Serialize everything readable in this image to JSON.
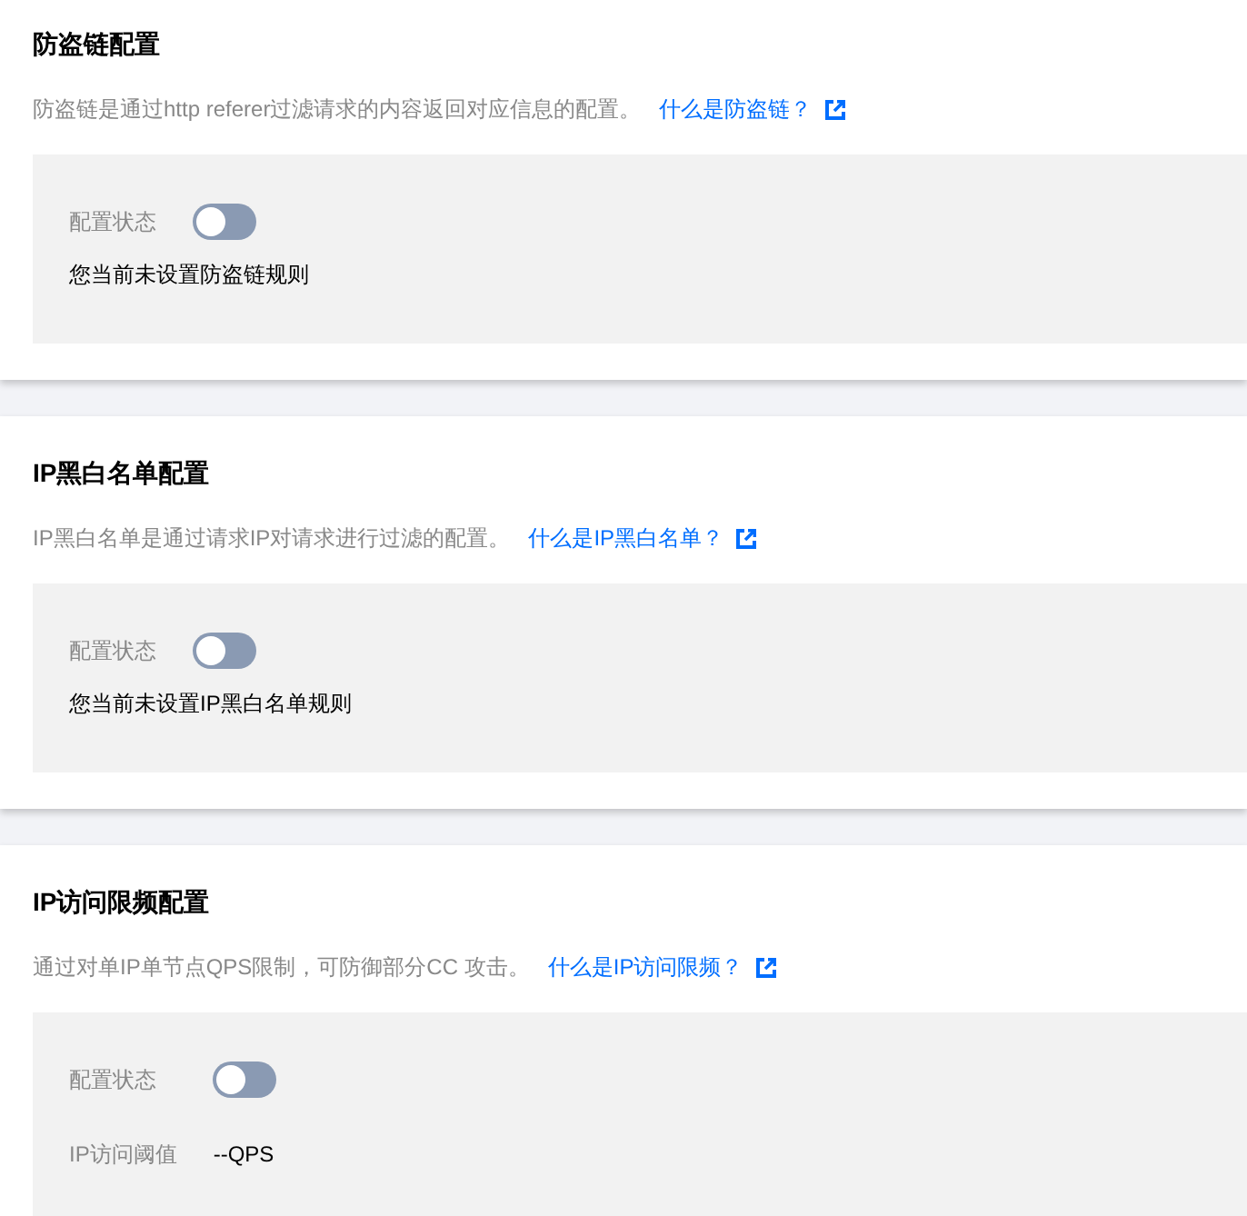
{
  "sections": [
    {
      "title": "防盗链配置",
      "description": "防盗链是通过http referer过滤请求的内容返回对应信息的配置。",
      "help_link": "什么是防盗链？",
      "fields": [
        {
          "kind": "switch",
          "label": "配置状态",
          "on": false
        }
      ],
      "message": "您当前未设置防盗链规则"
    },
    {
      "title": "IP黑白名单配置",
      "description": "IP黑白名单是通过请求IP对请求进行过滤的配置。",
      "help_link": "什么是IP黑白名单？",
      "fields": [
        {
          "kind": "switch",
          "label": "配置状态",
          "on": false
        }
      ],
      "message": "您当前未设置IP黑白名单规则"
    },
    {
      "title": "IP访问限频配置",
      "description": "通过对单IP单节点QPS限制，可防御部分CC 攻击。",
      "help_link": "什么是IP访问限频？",
      "fields": [
        {
          "kind": "switch",
          "label": "配置状态",
          "on": false
        },
        {
          "kind": "value",
          "label": "IP访问阈值",
          "value": "--QPS"
        }
      ]
    }
  ]
}
